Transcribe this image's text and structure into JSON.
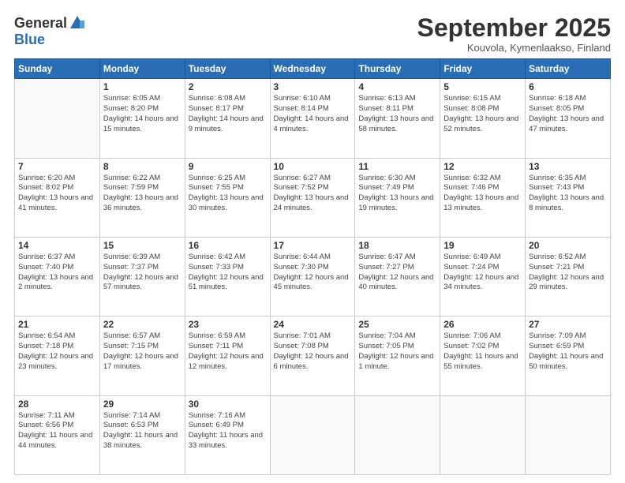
{
  "logo": {
    "general": "General",
    "blue": "Blue"
  },
  "title": "September 2025",
  "subtitle": "Kouvola, Kymenlaakso, Finland",
  "days_of_week": [
    "Sunday",
    "Monday",
    "Tuesday",
    "Wednesday",
    "Thursday",
    "Friday",
    "Saturday"
  ],
  "weeks": [
    [
      {
        "day": "",
        "sunrise": "",
        "sunset": "",
        "daylight": ""
      },
      {
        "day": "1",
        "sunrise": "Sunrise: 6:05 AM",
        "sunset": "Sunset: 8:20 PM",
        "daylight": "Daylight: 14 hours and 15 minutes."
      },
      {
        "day": "2",
        "sunrise": "Sunrise: 6:08 AM",
        "sunset": "Sunset: 8:17 PM",
        "daylight": "Daylight: 14 hours and 9 minutes."
      },
      {
        "day": "3",
        "sunrise": "Sunrise: 6:10 AM",
        "sunset": "Sunset: 8:14 PM",
        "daylight": "Daylight: 14 hours and 4 minutes."
      },
      {
        "day": "4",
        "sunrise": "Sunrise: 6:13 AM",
        "sunset": "Sunset: 8:11 PM",
        "daylight": "Daylight: 13 hours and 58 minutes."
      },
      {
        "day": "5",
        "sunrise": "Sunrise: 6:15 AM",
        "sunset": "Sunset: 8:08 PM",
        "daylight": "Daylight: 13 hours and 52 minutes."
      },
      {
        "day": "6",
        "sunrise": "Sunrise: 6:18 AM",
        "sunset": "Sunset: 8:05 PM",
        "daylight": "Daylight: 13 hours and 47 minutes."
      }
    ],
    [
      {
        "day": "7",
        "sunrise": "Sunrise: 6:20 AM",
        "sunset": "Sunset: 8:02 PM",
        "daylight": "Daylight: 13 hours and 41 minutes."
      },
      {
        "day": "8",
        "sunrise": "Sunrise: 6:22 AM",
        "sunset": "Sunset: 7:59 PM",
        "daylight": "Daylight: 13 hours and 36 minutes."
      },
      {
        "day": "9",
        "sunrise": "Sunrise: 6:25 AM",
        "sunset": "Sunset: 7:55 PM",
        "daylight": "Daylight: 13 hours and 30 minutes."
      },
      {
        "day": "10",
        "sunrise": "Sunrise: 6:27 AM",
        "sunset": "Sunset: 7:52 PM",
        "daylight": "Daylight: 13 hours and 24 minutes."
      },
      {
        "day": "11",
        "sunrise": "Sunrise: 6:30 AM",
        "sunset": "Sunset: 7:49 PM",
        "daylight": "Daylight: 13 hours and 19 minutes."
      },
      {
        "day": "12",
        "sunrise": "Sunrise: 6:32 AM",
        "sunset": "Sunset: 7:46 PM",
        "daylight": "Daylight: 13 hours and 13 minutes."
      },
      {
        "day": "13",
        "sunrise": "Sunrise: 6:35 AM",
        "sunset": "Sunset: 7:43 PM",
        "daylight": "Daylight: 13 hours and 8 minutes."
      }
    ],
    [
      {
        "day": "14",
        "sunrise": "Sunrise: 6:37 AM",
        "sunset": "Sunset: 7:40 PM",
        "daylight": "Daylight: 13 hours and 2 minutes."
      },
      {
        "day": "15",
        "sunrise": "Sunrise: 6:39 AM",
        "sunset": "Sunset: 7:37 PM",
        "daylight": "Daylight: 12 hours and 57 minutes."
      },
      {
        "day": "16",
        "sunrise": "Sunrise: 6:42 AM",
        "sunset": "Sunset: 7:33 PM",
        "daylight": "Daylight: 12 hours and 51 minutes."
      },
      {
        "day": "17",
        "sunrise": "Sunrise: 6:44 AM",
        "sunset": "Sunset: 7:30 PM",
        "daylight": "Daylight: 12 hours and 45 minutes."
      },
      {
        "day": "18",
        "sunrise": "Sunrise: 6:47 AM",
        "sunset": "Sunset: 7:27 PM",
        "daylight": "Daylight: 12 hours and 40 minutes."
      },
      {
        "day": "19",
        "sunrise": "Sunrise: 6:49 AM",
        "sunset": "Sunset: 7:24 PM",
        "daylight": "Daylight: 12 hours and 34 minutes."
      },
      {
        "day": "20",
        "sunrise": "Sunrise: 6:52 AM",
        "sunset": "Sunset: 7:21 PM",
        "daylight": "Daylight: 12 hours and 29 minutes."
      }
    ],
    [
      {
        "day": "21",
        "sunrise": "Sunrise: 6:54 AM",
        "sunset": "Sunset: 7:18 PM",
        "daylight": "Daylight: 12 hours and 23 minutes."
      },
      {
        "day": "22",
        "sunrise": "Sunrise: 6:57 AM",
        "sunset": "Sunset: 7:15 PM",
        "daylight": "Daylight: 12 hours and 17 minutes."
      },
      {
        "day": "23",
        "sunrise": "Sunrise: 6:59 AM",
        "sunset": "Sunset: 7:11 PM",
        "daylight": "Daylight: 12 hours and 12 minutes."
      },
      {
        "day": "24",
        "sunrise": "Sunrise: 7:01 AM",
        "sunset": "Sunset: 7:08 PM",
        "daylight": "Daylight: 12 hours and 6 minutes."
      },
      {
        "day": "25",
        "sunrise": "Sunrise: 7:04 AM",
        "sunset": "Sunset: 7:05 PM",
        "daylight": "Daylight: 12 hours and 1 minute."
      },
      {
        "day": "26",
        "sunrise": "Sunrise: 7:06 AM",
        "sunset": "Sunset: 7:02 PM",
        "daylight": "Daylight: 11 hours and 55 minutes."
      },
      {
        "day": "27",
        "sunrise": "Sunrise: 7:09 AM",
        "sunset": "Sunset: 6:59 PM",
        "daylight": "Daylight: 11 hours and 50 minutes."
      }
    ],
    [
      {
        "day": "28",
        "sunrise": "Sunrise: 7:11 AM",
        "sunset": "Sunset: 6:56 PM",
        "daylight": "Daylight: 11 hours and 44 minutes."
      },
      {
        "day": "29",
        "sunrise": "Sunrise: 7:14 AM",
        "sunset": "Sunset: 6:53 PM",
        "daylight": "Daylight: 11 hours and 38 minutes."
      },
      {
        "day": "30",
        "sunrise": "Sunrise: 7:16 AM",
        "sunset": "Sunset: 6:49 PM",
        "daylight": "Daylight: 11 hours and 33 minutes."
      },
      {
        "day": "",
        "sunrise": "",
        "sunset": "",
        "daylight": ""
      },
      {
        "day": "",
        "sunrise": "",
        "sunset": "",
        "daylight": ""
      },
      {
        "day": "",
        "sunrise": "",
        "sunset": "",
        "daylight": ""
      },
      {
        "day": "",
        "sunrise": "",
        "sunset": "",
        "daylight": ""
      }
    ]
  ]
}
